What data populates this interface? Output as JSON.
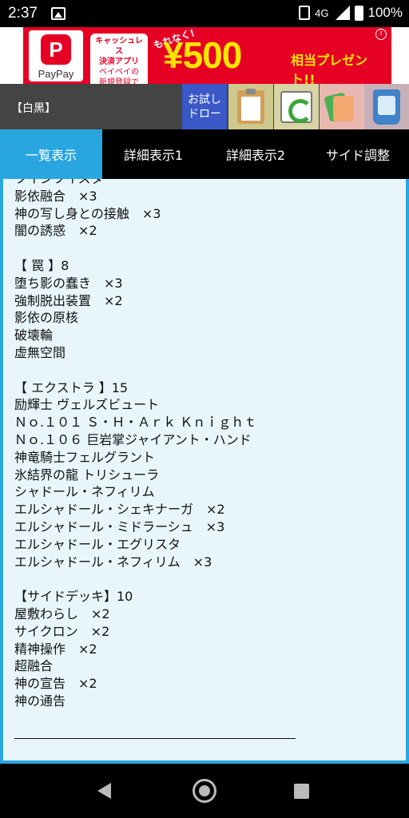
{
  "status_bar": {
    "time": "2:37",
    "network": "4G",
    "battery": "100%"
  },
  "ad": {
    "brand": "PayPay",
    "logo_glyph": "P",
    "copy_line1": "キャッシュレス",
    "copy_line2": "決済アプリ",
    "copy_line3": "ペイペイの",
    "copy_line4": "新規登録で",
    "motenaku": "もれなく!",
    "price": "¥500",
    "tail": "相当プレゼント!!",
    "info": "i",
    "color": "#e60024"
  },
  "toolbar": {
    "deck_title": "【白黒】",
    "draw_line1": "お試し",
    "draw_line2": "ドロー"
  },
  "tabs": [
    {
      "label": "一覧表示",
      "active": true
    },
    {
      "label": "詳細表示1",
      "active": false
    },
    {
      "label": "詳細表示2",
      "active": false
    },
    {
      "label": "サイド調整",
      "active": false
    }
  ],
  "deck_lines": [
    "ツインツイスター",
    "影依融合　×3",
    "神の写し身との接触　×3",
    "闇の誘惑　×2",
    "",
    "【 罠 】8",
    "堕ち影の蠢き　×3",
    "強制脱出装置　×2",
    "影依の原核",
    "破壊輪",
    "虚無空間",
    "",
    "【 エクストラ 】15",
    "励輝士 ヴェルズビュート",
    "Ｎｏ.１０１ Ｓ・Ｈ・Ａｒｋ Ｋｎｉｇｈｔ",
    "Ｎｏ.１０６ 巨岩掌ジャイアント・ハンド",
    "神竜騎士フェルグラント",
    "氷結界の龍 トリシューラ",
    "シャドール・ネフィリム",
    "エルシャドール・シェキナーガ　×2",
    "エルシャドール・ミドラーシュ　×3",
    "エルシャドール・エグリスタ",
    "エルシャドール・ネフィリム　×3",
    "",
    "【サイドデッキ】10",
    "屋敷わらし　×2",
    "サイクロン　×2",
    "精神操作　×2",
    "超融合",
    "神の宣告　×2",
    "神の通告"
  ],
  "colors": {
    "accent": "#29a6e0",
    "content_bg": "#e8f6fc",
    "toolbar_bg": "#444444"
  }
}
